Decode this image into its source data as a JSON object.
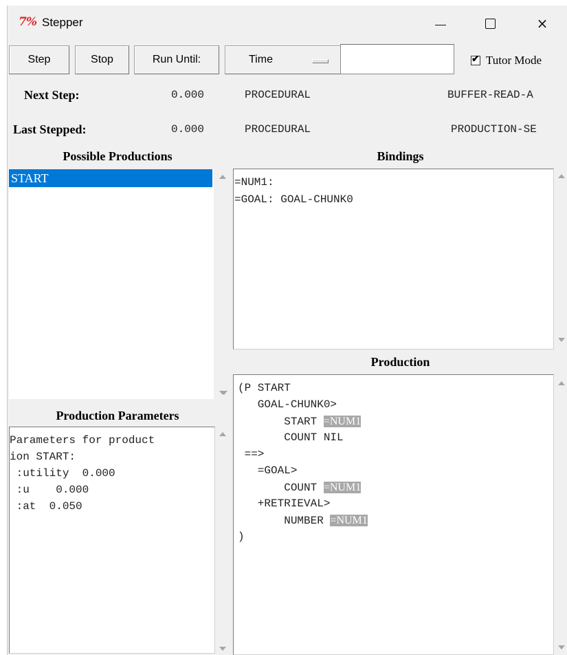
{
  "window": {
    "title": "Stepper",
    "app_icon": "7%",
    "controls": {
      "minimize": "minimize-icon",
      "maximize": "maximize-icon",
      "close": "×"
    }
  },
  "toolbar": {
    "step_label": "Step",
    "stop_label": "Stop",
    "run_until_label": "Run Until:",
    "time_select": "Time",
    "run_until_value": "",
    "tutor_mode_label": "Tutor Mode",
    "tutor_mode_checked": true,
    "check_glyph": "✔"
  },
  "next_step": {
    "label": "Next Step:",
    "time": "0.000",
    "module": "PROCEDURAL",
    "event": "BUFFER-READ-A"
  },
  "last_stepped": {
    "label": "Last Stepped:",
    "time": "0.000",
    "module": "PROCEDURAL",
    "event": "PRODUCTION-SE"
  },
  "possible_productions": {
    "heading": "Possible Productions",
    "items": [
      "START"
    ]
  },
  "bindings": {
    "heading": "Bindings",
    "lines": [
      "=NUM1:",
      "=GOAL: GOAL-CHUNK0"
    ]
  },
  "production_parameters": {
    "heading": "Production Parameters",
    "lines": [
      "Parameters for product",
      "ion START:",
      " :utility  0.000",
      " :u    0.000",
      " :at  0.050"
    ]
  },
  "production": {
    "heading": "Production",
    "lines": {
      "l1": "(P START",
      "l2": "   GOAL-CHUNK0>",
      "l3a": "       START ",
      "l3b": "=NUM1",
      "l4": "       COUNT NIL",
      "l5": " ==>",
      "l6": "   =GOAL>",
      "l7a": "       COUNT ",
      "l7b": "=NUM1",
      "l8": "   +RETRIEVAL>",
      "l9a": "       NUMBER ",
      "l9b": "=NUM1",
      "l10": ")"
    }
  },
  "colors": {
    "selection": "#0078d7",
    "highlight": "#a8a8a8",
    "icon": "#e02828"
  }
}
